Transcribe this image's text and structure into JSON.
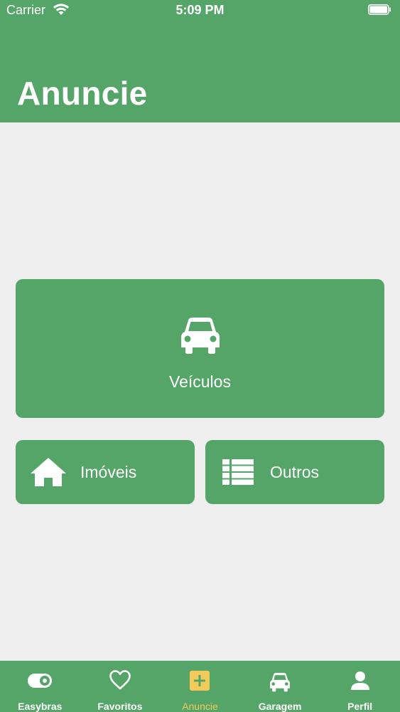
{
  "status_bar": {
    "carrier": "Carrier",
    "time": "5:09 PM"
  },
  "header": {
    "title": "Anuncie",
    "background": "#55a468"
  },
  "categories": {
    "vehicles": {
      "label": "Veículos",
      "icon": "car-icon"
    },
    "real_estate": {
      "label": "Imóveis",
      "icon": "house-icon"
    },
    "others": {
      "label": "Outros",
      "icon": "list-icon"
    }
  },
  "tab_bar": {
    "active_color": "#f2cb5a",
    "items": [
      {
        "label": "Easybras",
        "icon": "toggle-icon"
      },
      {
        "label": "Favoritos",
        "icon": "heart-icon"
      },
      {
        "label": "Anuncie",
        "icon": "plus-square-icon",
        "active": true
      },
      {
        "label": "Garagem",
        "icon": "car-icon"
      },
      {
        "label": "Perfil",
        "icon": "person-icon"
      }
    ]
  }
}
